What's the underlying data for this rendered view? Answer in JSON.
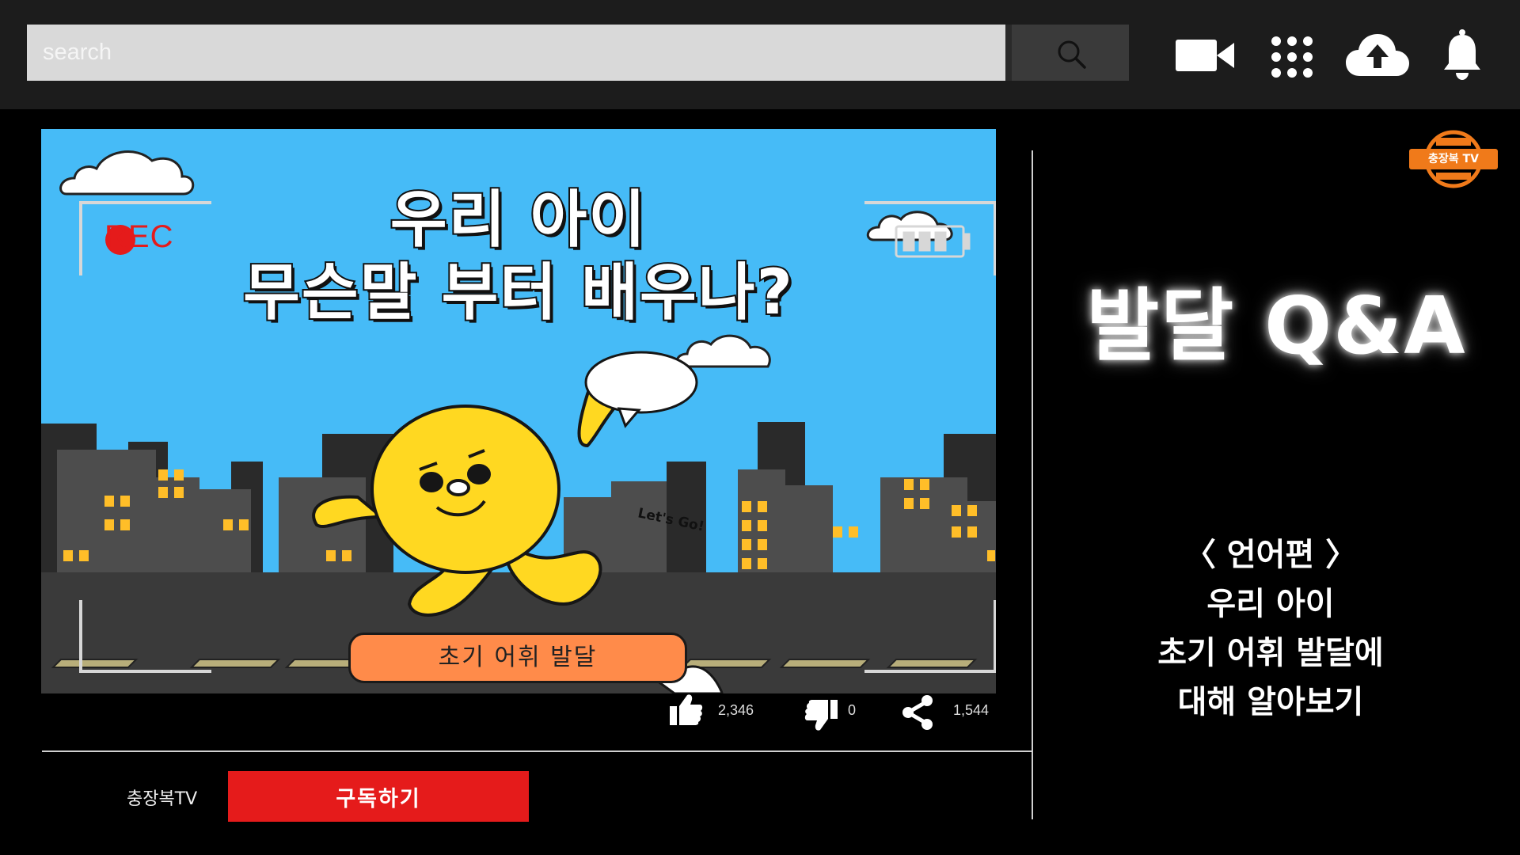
{
  "header": {
    "search": {
      "placeholder": "search",
      "value": ""
    },
    "icons": [
      "search-icon",
      "video-camera-icon",
      "apps-grid-icon",
      "upload-cloud-icon",
      "bell-icon"
    ]
  },
  "video": {
    "thumbnail": {
      "rec_label": "REC",
      "title_line1": "우리 아이",
      "title_line2": "무슨말 부터 배우나?",
      "speech_bubble": "Let's Go!",
      "cta_label": "초기 어휘 발달"
    },
    "stats": {
      "likes": "2,346",
      "dislikes": "0",
      "shares": "1,544"
    }
  },
  "channel": {
    "name": "충장복TV",
    "subscribe_label": "구독하기",
    "logo_text": "충장복 TV"
  },
  "panel": {
    "title": "발달 Q&A",
    "lines": [
      "〈 언어편 〉",
      "우리 아이",
      "초기 어휘 발달에",
      "대해 알아보기"
    ]
  },
  "colors": {
    "topbar": "#1c1c1c",
    "search_field": "#d9d9d9",
    "sky": "#46bbf7",
    "subscribe": "#e51b1b",
    "cta": "#ff8b4a",
    "character": "#ffd821"
  }
}
